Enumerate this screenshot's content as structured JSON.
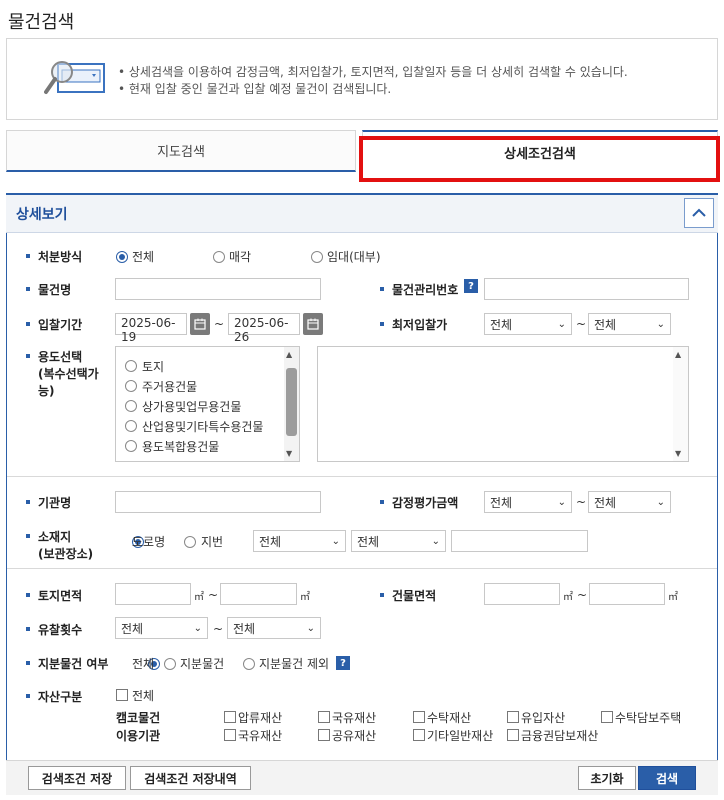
{
  "page": {
    "title": "물건검색"
  },
  "info": {
    "lines": [
      "• 상세검색을 이용하여 감정금액, 최저입찰가, 토지면적, 입찰일자 등을 더 상세히 검색할 수 있습니다.",
      "• 현재 입찰 중인 물건과 입찰 예정 물건이 검색됩니다."
    ]
  },
  "tabs": {
    "map": "지도검색",
    "detail": "상세조건검색"
  },
  "panel": {
    "title": "상세보기"
  },
  "form": {
    "disposal": {
      "label": "처분방식",
      "options": [
        "전체",
        "매각",
        "임대(대부)"
      ]
    },
    "item_name": {
      "label": "물건명",
      "value": ""
    },
    "item_no": {
      "label": "물건관리번호",
      "value": "",
      "help": "?"
    },
    "bid_period": {
      "label": "입찰기간",
      "from": "2025-06-19",
      "to": "2025-06-26",
      "sep": "~"
    },
    "min_bid": {
      "label": "최저입찰가",
      "from": "전체",
      "to": "전체",
      "sep": "~"
    },
    "usage": {
      "label_lines": [
        "용도선택",
        "(복수선택가",
        "능)"
      ],
      "items": [
        "토지",
        "주거용건물",
        "상가용및업무용건물",
        "산업용및기타특수용건물",
        "용도복합용건물"
      ]
    },
    "agency": {
      "label": "기관명",
      "value": ""
    },
    "appraisal": {
      "label": "감정평가금액",
      "from": "전체",
      "to": "전체",
      "sep": "~"
    },
    "location": {
      "label_lines": [
        "소재지",
        "(보관장소)"
      ],
      "options": [
        "도로명",
        "지번"
      ],
      "sel1": "전체",
      "sel2": "전체",
      "value": ""
    },
    "land_area": {
      "label": "토지면적",
      "unit": "㎡",
      "sep": "~"
    },
    "bldg_area": {
      "label": "건물면적",
      "unit": "㎡",
      "sep": "~"
    },
    "fail_count": {
      "label": "유찰횟수",
      "from": "전체",
      "to": "전체",
      "sep": "~"
    },
    "share": {
      "label": "지분물건 여부",
      "options": [
        "전체",
        "지분물건",
        "지분물건 제외"
      ],
      "help": "?"
    },
    "asset": {
      "label": "자산구분",
      "all": "전체",
      "camco_label": "캠코물건",
      "camco": [
        "압류재산",
        "국유재산",
        "수탁재산",
        "유입자산",
        "수탁담보주택"
      ],
      "agency_label": "이용기관",
      "agencies": [
        "국유재산",
        "공유재산",
        "기타일반재산",
        "금융권담보재산"
      ]
    }
  },
  "buttons": {
    "save": "검색조건 저장",
    "save_history": "검색조건 저장내역",
    "reset": "초기화",
    "search": "검색"
  },
  "colors": {
    "accent": "#2a5ea8",
    "highlight": "#e31010"
  }
}
